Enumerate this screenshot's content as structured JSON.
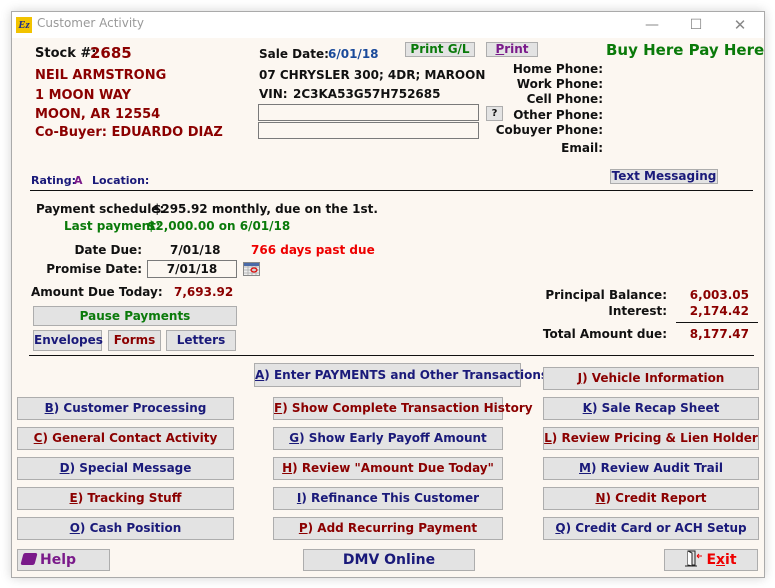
{
  "window": {
    "title": "Customer Activity",
    "app_icon": "Ez",
    "controls": {
      "minimize": "—",
      "maximize": "☐",
      "close": "✕"
    }
  },
  "customer": {
    "stock_label": "Stock #:",
    "stock_number": "2685",
    "name": "NEIL ARMSTRONG",
    "address1": "1 MOON WAY",
    "address2": "MOON, AR 12554",
    "cobuyer": "Co-Buyer: EDUARDO DIAZ"
  },
  "vehicle": {
    "sale_date_label": "Sale Date:",
    "sale_date": "6/01/18",
    "description": "07 CHRYSLER 300; 4DR; MAROON",
    "vin_label": "VIN:",
    "vin": "2C3KA53G57H752685",
    "note1": "",
    "note2": "",
    "help_button": "?"
  },
  "top_buttons": {
    "print_gl": "Print G/L",
    "print_u": "P",
    "print_rest": "rint"
  },
  "brand": "Buy Here Pay Here",
  "contact": {
    "home_phone": "Home Phone:",
    "work_phone": "Work Phone:",
    "cell_phone": "Cell Phone:",
    "other_phone": "Other Phone:",
    "cobuyer_phone": "Cobuyer Phone:",
    "email": "Email:",
    "text_messaging": "Text Messaging"
  },
  "rating": {
    "label": "Rating:",
    "value": "A",
    "location_label": "Location:",
    "location": ""
  },
  "payment": {
    "schedule_label": "Payment schedule:",
    "schedule": "$295.92 monthly, due on the 1st.",
    "last_label": "Last payment:",
    "last": "$2,000.00 on  6/01/18",
    "date_due_label": "Date Due:",
    "date_due": "7/01/18",
    "past_due": "766 days past due",
    "promise_label": "Promise Date:",
    "promise_date": "7/01/18",
    "amount_due_label": "Amount Due Today:",
    "amount_due": "7,693.92"
  },
  "balance": {
    "principal_label": "Principal Balance:",
    "principal": "6,003.05",
    "interest_label": "Interest:",
    "interest": "2,174.42",
    "total_label": "Total Amount due:",
    "total": "8,177.47"
  },
  "small_buttons": {
    "pause": "Pause Payments",
    "envelopes": "Envelopes",
    "forms": "Forms",
    "letters": "Letters"
  },
  "menu": {
    "a": {
      "key": "A",
      "text": ") Enter PAYMENTS and Other Transactions"
    },
    "b": {
      "key": "B",
      "text": ") Customer Processing"
    },
    "c": {
      "key": "C",
      "text": ") General Contact Activity"
    },
    "d": {
      "key": "D",
      "text": ") Special Message"
    },
    "e": {
      "key": "E",
      "text": ") Tracking Stuff"
    },
    "f": {
      "key": "F",
      "text": ") Show Complete Transaction History"
    },
    "g": {
      "key": "G",
      "text": ") Show Early Payoff Amount"
    },
    "h": {
      "key": "H",
      "text": ") Review \"Amount Due Today\""
    },
    "i": {
      "key": "I",
      "text": ") Refinance This Customer"
    },
    "j": {
      "key": "J",
      "text": ") Vehicle Information"
    },
    "k": {
      "key": "K",
      "text": ") Sale Recap Sheet"
    },
    "l": {
      "key": "L",
      "text": ") Review Pricing & Lien Holder"
    },
    "m": {
      "key": "M",
      "text": ") Review Audit Trail"
    },
    "n": {
      "key": "N",
      "text": ") Credit Report"
    },
    "o": {
      "key": "O",
      "text": ") Cash Position"
    },
    "p": {
      "key": "P",
      "text": ") Add Recurring Payment"
    },
    "q": {
      "key": "Q",
      "text": ") Credit Card or ACH Setup"
    }
  },
  "footer": {
    "help": "Help",
    "dmv": "DMV Online",
    "exit_pre": "E",
    "exit_u": "x",
    "exit_post": "it"
  },
  "colors": {
    "background": "#fcf7f1",
    "button": "#e3e3e3",
    "maroon": "#8b0000",
    "navy": "#1a1a7a",
    "green": "#0a7a0a",
    "red": "#ee0000"
  }
}
